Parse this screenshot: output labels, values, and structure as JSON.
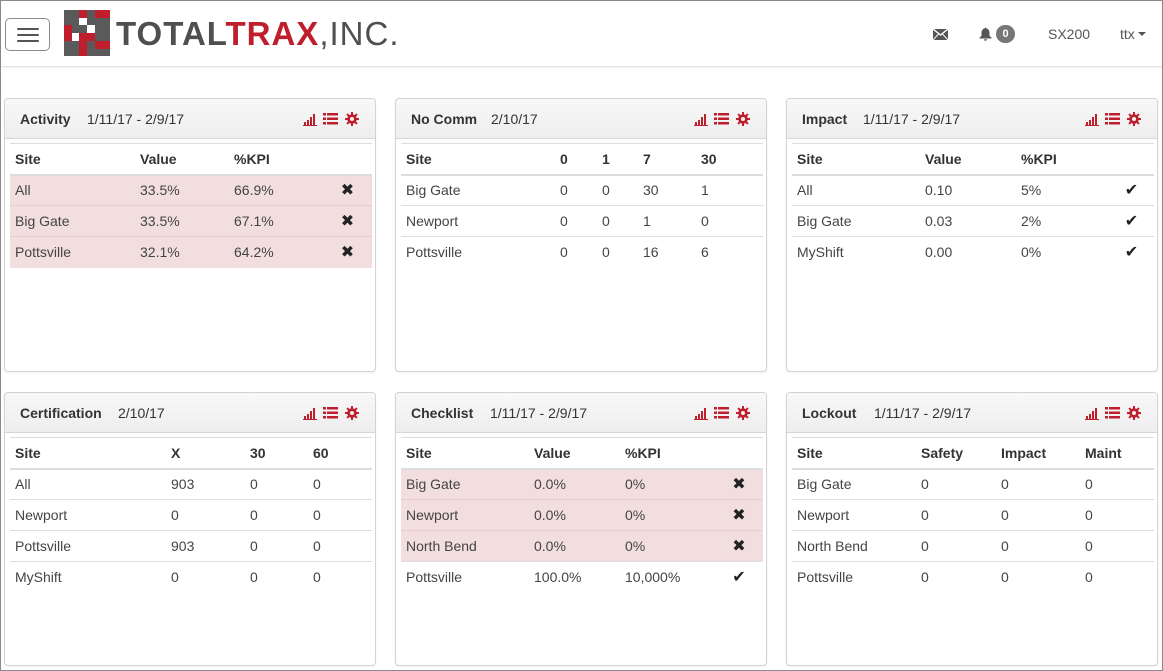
{
  "brand": {
    "word_part1": "TOTAL",
    "word_part2": "TRAX",
    "suffix": ",INC.",
    "colors": {
      "gray": "#4f4f4f",
      "red": "#bf1e2d"
    }
  },
  "nav": {
    "menu_icon": "hamburger-icon",
    "mail_icon": "envelope-icon",
    "bell_icon": "bell-icon",
    "notification_count": "0",
    "site": "SX200",
    "user": "ttx"
  },
  "icons": {
    "chart": "bar-chart-icon",
    "list": "list-icon",
    "settings": "gear-icon"
  },
  "panels": {
    "activity": {
      "title": "Activity",
      "date": "1/11/17 - 2/9/17",
      "headers": [
        "Site",
        "Value",
        "%KPI",
        ""
      ],
      "rows": [
        [
          "All",
          "33.5%",
          "66.9%",
          "✖"
        ],
        [
          "Big Gate",
          "33.5%",
          "67.1%",
          "✖"
        ],
        [
          "Pottsville",
          "32.1%",
          "64.2%",
          "✖"
        ]
      ]
    },
    "nocomm": {
      "title": "No Comm",
      "date": "2/10/17",
      "headers": [
        "Site",
        "0",
        "1",
        "7",
        "30"
      ],
      "rows": [
        [
          "Big Gate",
          "0",
          "0",
          "30",
          "1"
        ],
        [
          "Newport",
          "0",
          "0",
          "1",
          "0"
        ],
        [
          "Pottsville",
          "0",
          "0",
          "16",
          "6"
        ]
      ]
    },
    "impact": {
      "title": "Impact",
      "date": "1/11/17 - 2/9/17",
      "headers": [
        "Site",
        "Value",
        "%KPI",
        ""
      ],
      "rows": [
        [
          "All",
          "0.10",
          "5%",
          "✔"
        ],
        [
          "Big Gate",
          "0.03",
          "2%",
          "✔"
        ],
        [
          "MyShift",
          "0.00",
          "0%",
          "✔"
        ]
      ]
    },
    "certification": {
      "title": "Certification",
      "date": "2/10/17",
      "headers": [
        "Site",
        "X",
        "30",
        "60"
      ],
      "rows": [
        [
          "All",
          "903",
          "0",
          "0"
        ],
        [
          "Newport",
          "0",
          "0",
          "0"
        ],
        [
          "Pottsville",
          "903",
          "0",
          "0"
        ],
        [
          "MyShift",
          "0",
          "0",
          "0"
        ]
      ]
    },
    "checklist": {
      "title": "Checklist",
      "date": "1/11/17 - 2/9/17",
      "headers": [
        "Site",
        "Value",
        "%KPI",
        ""
      ],
      "rows": [
        [
          "Big Gate",
          "0.0%",
          "0%",
          "✖"
        ],
        [
          "Newport",
          "0.0%",
          "0%",
          "✖"
        ],
        [
          "North Bend",
          "0.0%",
          "0%",
          "✖"
        ],
        [
          "Pottsville",
          "100.0%",
          "10,000%",
          "✔"
        ]
      ]
    },
    "lockout": {
      "title": "Lockout",
      "date": "1/11/17 - 2/9/17",
      "headers": [
        "Site",
        "Safety",
        "Impact",
        "Maint"
      ],
      "rows": [
        [
          "Big Gate",
          "0",
          "0",
          "0"
        ],
        [
          "Newport",
          "0",
          "0",
          "0"
        ],
        [
          "North Bend",
          "0",
          "0",
          "0"
        ],
        [
          "Pottsville",
          "0",
          "0",
          "0"
        ]
      ]
    }
  },
  "colors": {
    "fail_row": "#f2dede",
    "tool_icon": "#bf1e2d",
    "badge": "#777777"
  }
}
